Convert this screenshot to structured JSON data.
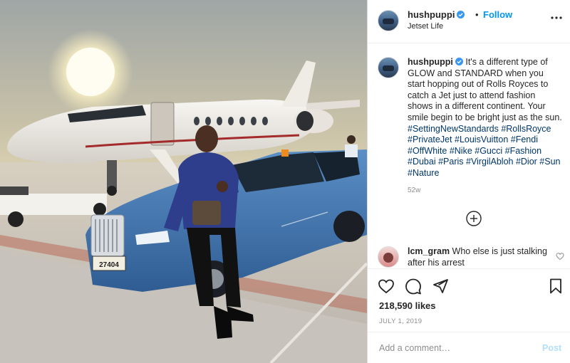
{
  "header": {
    "username": "hushpuppi",
    "dot": "•",
    "follow_label": "Follow",
    "location": "Jetset Life",
    "verified_icon": "verified-badge-icon",
    "more_icon": "more-options-icon"
  },
  "caption": {
    "username": "hushpuppi",
    "text": "It's a different type of GLOW and STANDARD when you start hopping out of Rolls Royces to catch a Jet just to attend fashion shows in a different continent. Your smile begin to be bright just as the sun.",
    "hashtags": "#SettingNewStandards #RollsRoyce #PrivateJet #LouisVuitton #Fendi #OffWhite #Nike #Gucci #Fashion #Dubai #Paris #VirgilAbloh #Dior #Sun #Nature",
    "time_ago": "52w"
  },
  "comments": [
    {
      "username": "lcm_gram",
      "text": "Who else is just stalking after his arrest"
    }
  ],
  "photo": {
    "plate_text": "27404"
  },
  "likes": "218,590 likes",
  "date": "JULY 1, 2019",
  "add_comment": {
    "placeholder": "Add a comment…",
    "post_label": "Post"
  },
  "colors": {
    "link_blue": "#0095f6",
    "hashtag_blue": "#00376b",
    "muted_gray": "#8e8e8e",
    "post_disabled": "#b2dffc"
  }
}
